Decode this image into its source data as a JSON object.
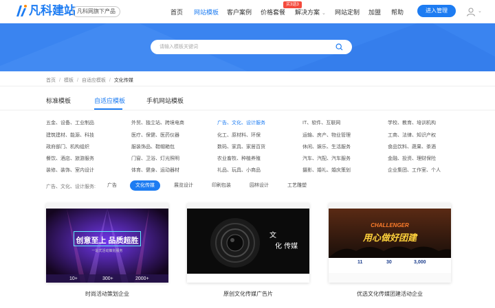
{
  "header": {
    "logo_text": "凡科建站",
    "logo_badge": "凡科网旗下产品",
    "nav": [
      {
        "label": "首页",
        "active": false
      },
      {
        "label": "网站模板",
        "active": true
      },
      {
        "label": "客户案例",
        "active": false
      },
      {
        "label": "价格套餐",
        "active": false
      },
      {
        "label": "解决方案",
        "active": false
      },
      {
        "label": "网站定制",
        "active": false
      },
      {
        "label": "加盟",
        "active": false
      },
      {
        "label": "帮助",
        "active": false
      }
    ],
    "hot_tag": "买3送3",
    "manage_button": "进入管理"
  },
  "search": {
    "placeholder": "请输入模板关键词"
  },
  "breadcrumb": [
    "首页",
    "模板",
    "自适应模板",
    "文化传媒"
  ],
  "tabs": [
    {
      "label": "标准模板",
      "active": false
    },
    {
      "label": "自适应模板",
      "active": true
    },
    {
      "label": "手机网站模板",
      "active": false
    }
  ],
  "categories": [
    [
      "五金、设备、工业制品",
      "建筑建材、能源、科技",
      "政府部门、机构组织",
      "餐饮、酒店、旅游服务",
      "装修、装饰、室内设计"
    ],
    [
      "外贸、独立站、跨境电商",
      "医疗、保健、医药仪器",
      "服装饰品、鞋帽箱包",
      "门窗、卫浴、灯光照明",
      "体育、健身、运动器材"
    ],
    [
      "广告、文化、设计服务",
      "化工、原材料、环保",
      "数码、家具、家居百货",
      "农业畜牧、种植养殖",
      "礼品、玩具、小商品"
    ],
    [
      "IT、软件、互联网",
      "运输、房产、物业管理",
      "休闲、娱乐、生活服务",
      "汽车、汽配、汽车服务",
      "摄影、婚礼、婚庆策划"
    ],
    [
      "学校、教育、培训机构",
      "工商、法律、知识产权",
      "食品饮料、蔬果、茶酒",
      "金融、投资、理财保险",
      "企业集团、工作室、个人"
    ]
  ],
  "filter": {
    "label": "广告、文化、设计服务:",
    "chips": [
      {
        "label": "广告",
        "active": false
      },
      {
        "label": "文化传媒",
        "active": true
      },
      {
        "label": "展览设计",
        "active": false
      },
      {
        "label": "印刷包装",
        "active": false
      },
      {
        "label": "园林设计",
        "active": false
      },
      {
        "label": "工艺雕塑",
        "active": false
      }
    ]
  },
  "cards": [
    {
      "caption": "时尚活动策划企业",
      "title": "创意至上 品质超胜",
      "subtitle": "一站式活动策划服务",
      "stats": [
        "10+",
        "300+",
        "2000+"
      ]
    },
    {
      "caption": "原创文化传媒广告片",
      "vertical_a": "文",
      "vertical_b": "化 传媒"
    },
    {
      "caption": "优选文化传媒团建活动企业",
      "title": "用心做好团建",
      "tagline": "CHALLENGER",
      "stats": [
        "11",
        "30",
        "3,000"
      ]
    }
  ],
  "colors": {
    "brand": "#1d7cf2",
    "banner": "#3a84f0",
    "hot": "#f44a3c"
  }
}
